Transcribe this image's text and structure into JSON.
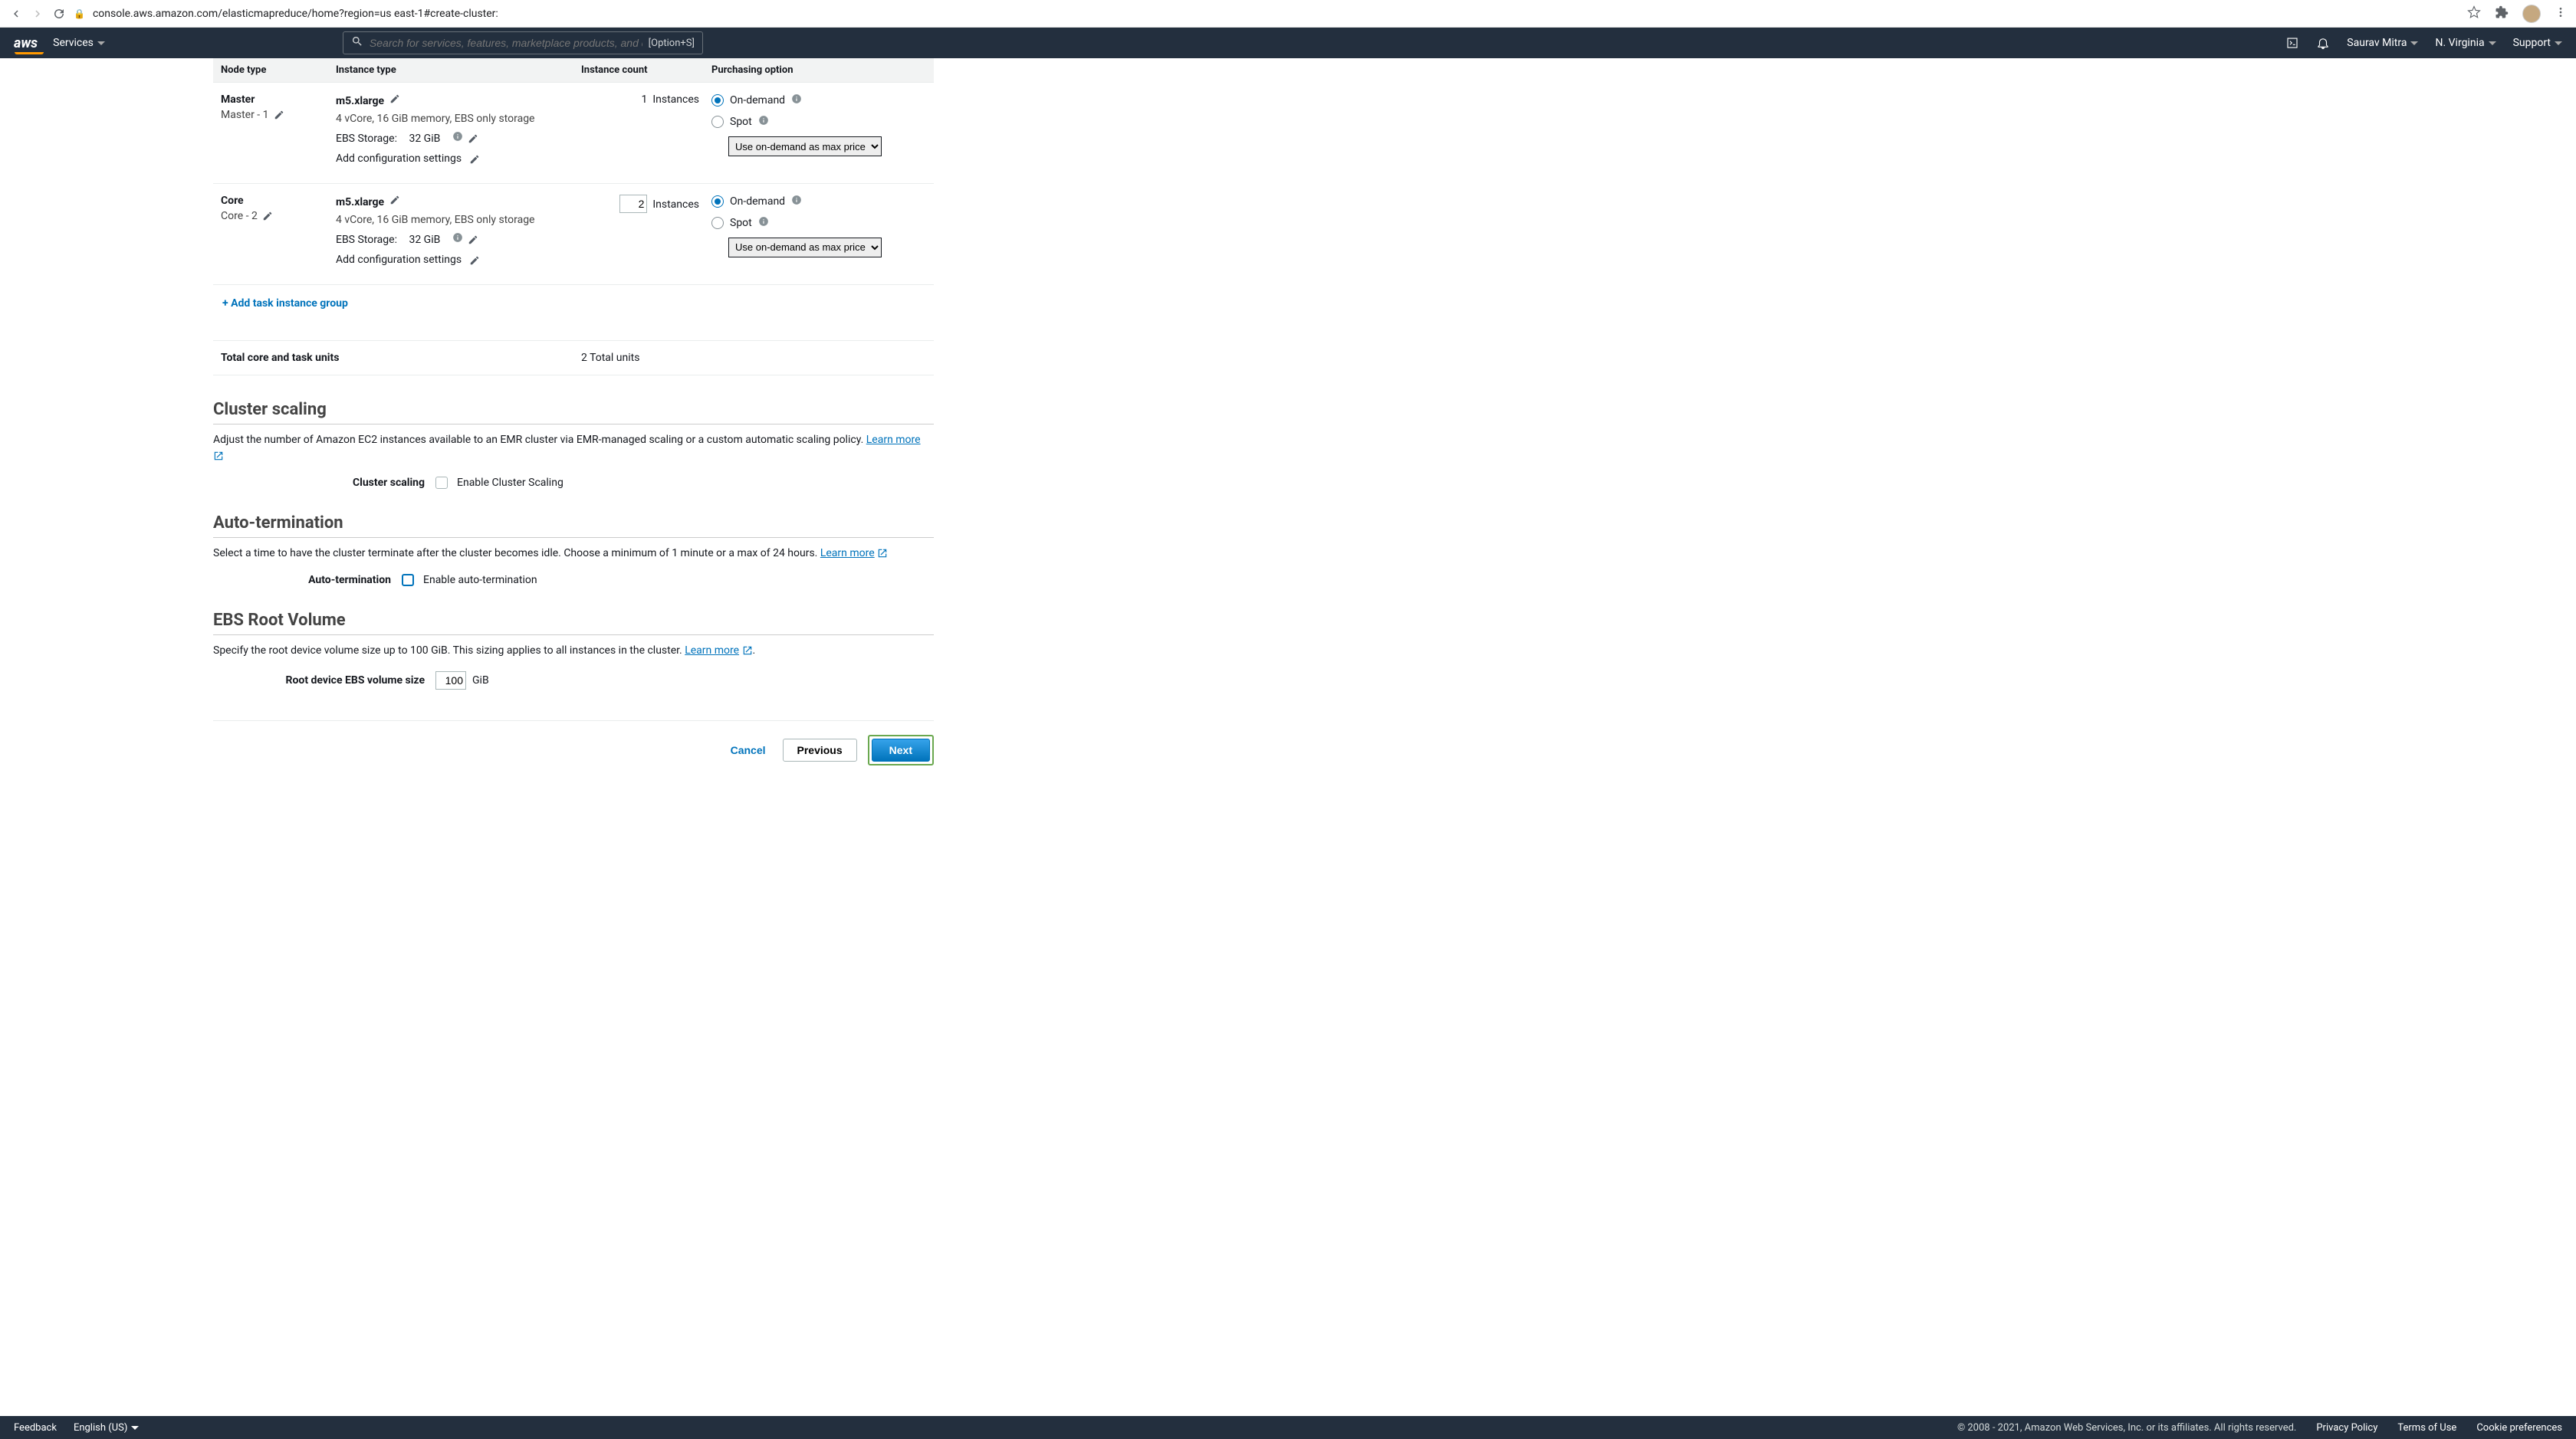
{
  "browser": {
    "url": "console.aws.amazon.com/elasticmapreduce/home?region=us east-1#create-cluster:"
  },
  "header": {
    "services_label": "Services",
    "search_placeholder": "Search for services, features, marketplace products, and docs",
    "search_shortcut": "[Option+S]",
    "username": "Saurav Mitra",
    "region": "N. Virginia",
    "support_label": "Support"
  },
  "table": {
    "columns": {
      "nodetype": "Node type",
      "instancetype": "Instance type",
      "count": "Instance count",
      "purchasing": "Purchasing option"
    },
    "rows": [
      {
        "type_label": "Master",
        "type_sub": "Master - 1",
        "instance_type": "m5.xlarge",
        "specs": "4 vCore, 16 GiB memory, EBS only storage",
        "storage_label": "EBS Storage:",
        "storage_value": "32 GiB",
        "add_config": "Add configuration settings",
        "count": "1",
        "count_editable": false,
        "count_unit": "Instances",
        "on_demand": "On-demand",
        "spot": "Spot",
        "spot_select": "Use on-demand as max price"
      },
      {
        "type_label": "Core",
        "type_sub": "Core - 2",
        "instance_type": "m5.xlarge",
        "specs": "4 vCore, 16 GiB memory, EBS only storage",
        "storage_label": "EBS Storage:",
        "storage_value": "32 GiB",
        "add_config": "Add configuration settings",
        "count": "2",
        "count_editable": true,
        "count_unit": "Instances",
        "on_demand": "On-demand",
        "spot": "Spot",
        "spot_select": "Use on-demand as max price"
      }
    ],
    "add_task": "+ Add task instance group",
    "totals_label": "Total core and task units",
    "totals_value": "2 Total units"
  },
  "scaling": {
    "title": "Cluster scaling",
    "desc": "Adjust the number of Amazon EC2 instances available to an EMR cluster via EMR-managed scaling or a custom automatic scaling policy. ",
    "learn_more": "Learn more",
    "field_label": "Cluster scaling",
    "checkbox_label": "Enable Cluster Scaling"
  },
  "autoterm": {
    "title": "Auto-termination",
    "desc": "Select a time to have the cluster terminate after the cluster becomes idle. Choose a minimum of 1 minute or a max of 24 hours. ",
    "learn_more": "Learn more",
    "field_label": "Auto-termination",
    "checkbox_label": "Enable auto-termination"
  },
  "ebs": {
    "title": "EBS Root Volume",
    "desc": "Specify the root device volume size up to 100 GiB. This sizing applies to all instances in the cluster. ",
    "learn_more": "Learn more",
    "field_label": "Root device EBS volume size",
    "value": "100",
    "unit": "GiB"
  },
  "buttons": {
    "cancel": "Cancel",
    "previous": "Previous",
    "next": "Next"
  },
  "footer": {
    "feedback": "Feedback",
    "language": "English (US)",
    "copyright": "© 2008 - 2021, Amazon Web Services, Inc. or its affiliates. All rights reserved.",
    "privacy": "Privacy Policy",
    "terms": "Terms of Use",
    "cookie": "Cookie preferences"
  }
}
